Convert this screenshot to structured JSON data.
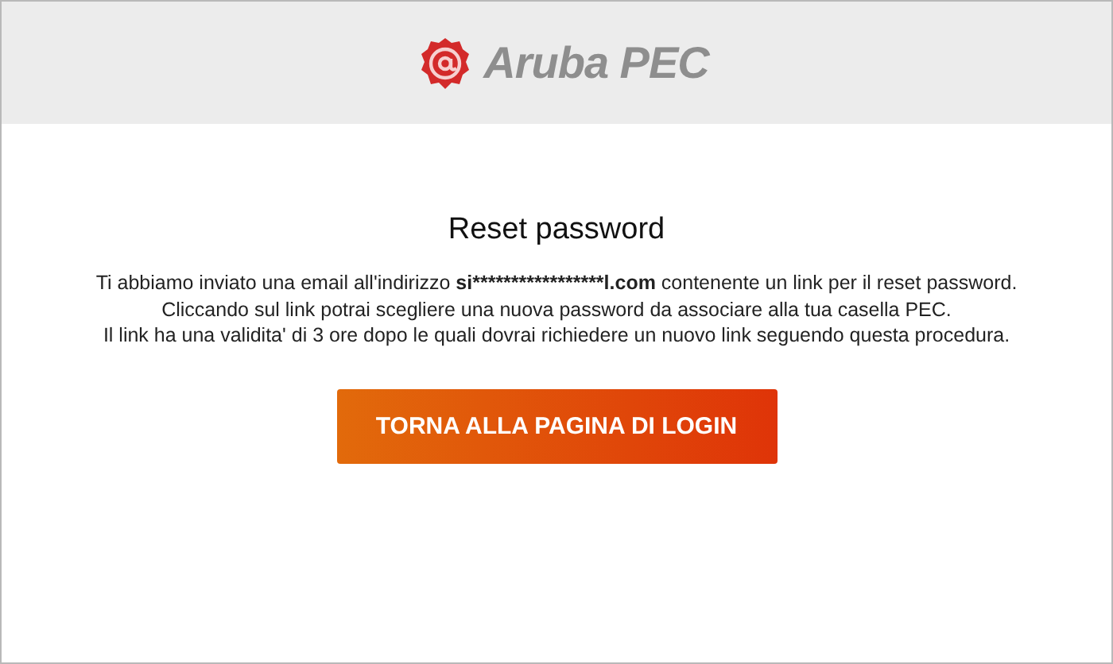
{
  "header": {
    "logo_text": "Aruba PEC"
  },
  "title": "Reset password",
  "message_lines": [
    [
      {
        "text": "Ti abbiamo inviato una email all'indirizzo ",
        "bold": false
      },
      {
        "text": "si*****************l.com",
        "bold": true
      },
      {
        "text": " contenente un link per il reset password.",
        "bold": false
      }
    ],
    [
      {
        "text": "Cliccando sul link potrai scegliere una nuova password da associare alla tua casella PEC.",
        "bold": false
      }
    ],
    [
      {
        "text": "Il link ha una validita' di 3 ore dopo le quali dovrai richiedere un nuovo link seguendo questa procedura.",
        "bold": false
      }
    ]
  ],
  "button": "TORNA ALLA PAGINA DI LOGIN"
}
